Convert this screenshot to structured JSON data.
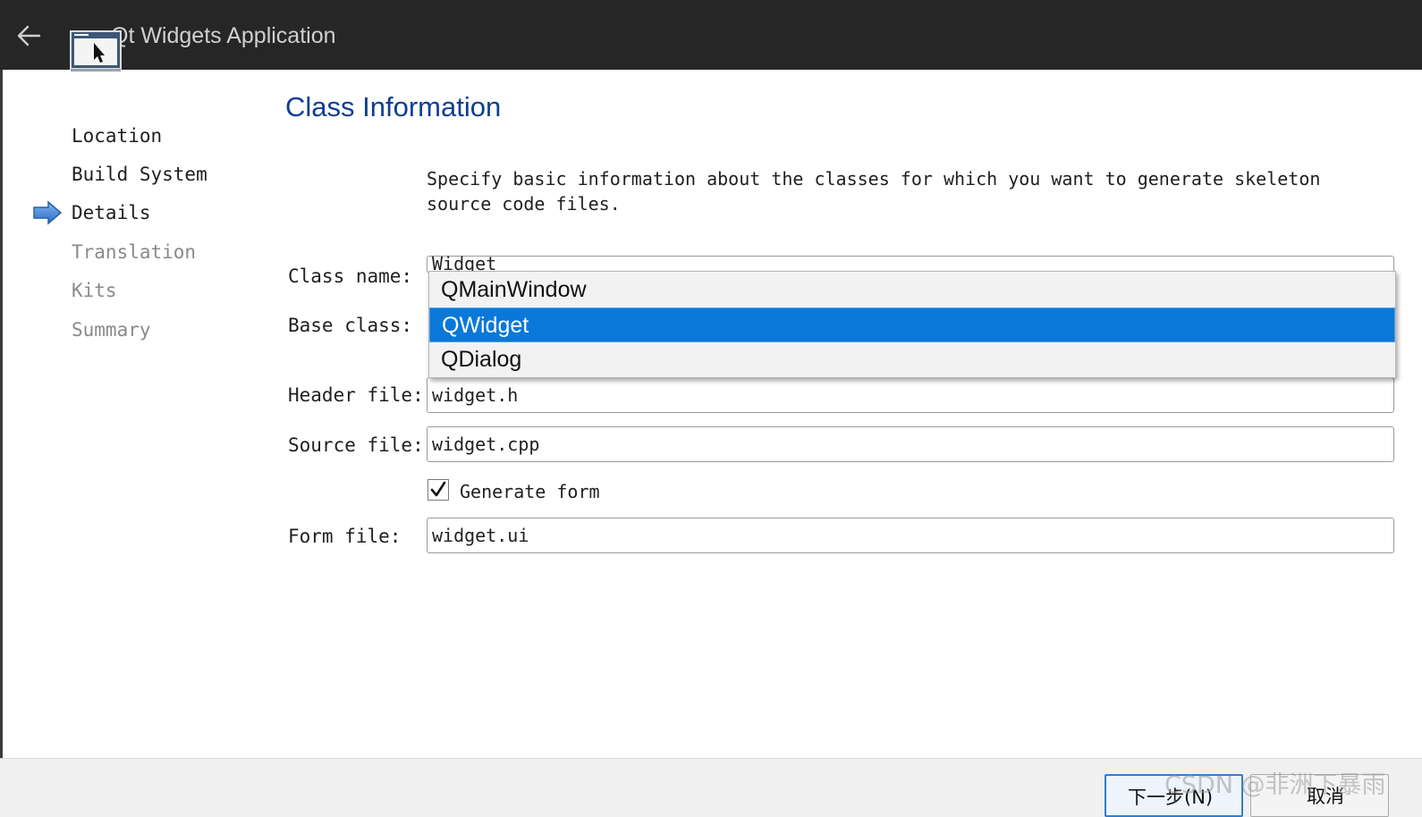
{
  "window": {
    "title": "Qt Widgets Application"
  },
  "steps": [
    {
      "label": "Location",
      "state": "done"
    },
    {
      "label": "Build System",
      "state": "done"
    },
    {
      "label": "Details",
      "state": "current"
    },
    {
      "label": "Translation",
      "state": "pending"
    },
    {
      "label": "Kits",
      "state": "pending"
    },
    {
      "label": "Summary",
      "state": "pending"
    }
  ],
  "page": {
    "title": "Class Information",
    "description": "Specify basic information about the classes for which you want to generate skeleton source code files."
  },
  "form": {
    "class_name_label": "Class name:",
    "class_name_value": "Widget",
    "base_class_label": "Base class:",
    "base_class_options": [
      "QMainWindow",
      "QWidget",
      "QDialog"
    ],
    "base_class_selected": "QWidget",
    "header_file_label": "Header file:",
    "header_file_value": "widget.h",
    "source_file_label": "Source file:",
    "source_file_value": "widget.cpp",
    "generate_form_label": "Generate form",
    "generate_form_checked": true,
    "form_file_label": "Form file:",
    "form_file_value": "widget.ui"
  },
  "buttons": {
    "next_label": "下一步(N)",
    "cancel_label": "取消"
  },
  "watermark": "CSDN @非洲下暴雨",
  "colors": {
    "titlebar_bg": "#262626",
    "title_accent": "#0f3e91",
    "selection": "#0a78d7",
    "current_step_arrow": "#3b7fd6"
  },
  "icons": {
    "back": "arrow-left-icon",
    "app": "qt-app-window-icon",
    "current_step": "arrow-right-icon",
    "checkbox": "check-icon"
  }
}
